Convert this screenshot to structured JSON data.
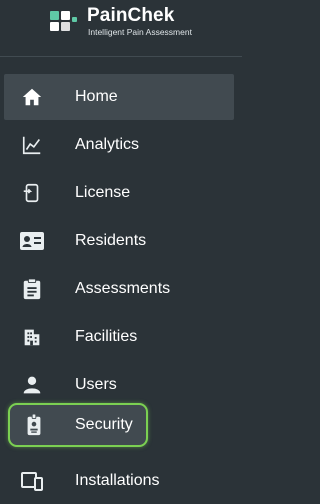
{
  "brand": {
    "name": "PainChek",
    "tagline": "Intelligent Pain Assessment"
  },
  "sidebar": {
    "items": [
      {
        "label": "Home",
        "icon": "home-icon",
        "state": "active"
      },
      {
        "label": "Analytics",
        "icon": "chart-line-icon"
      },
      {
        "label": "License",
        "icon": "license-icon"
      },
      {
        "label": "Residents",
        "icon": "id-card-icon"
      },
      {
        "label": "Assessments",
        "icon": "clipboard-icon"
      },
      {
        "label": "Facilities",
        "icon": "building-icon"
      },
      {
        "label": "Users",
        "icon": "user-icon"
      },
      {
        "label": "Security",
        "icon": "badge-icon",
        "state": "highlighted"
      },
      {
        "label": "Installations",
        "icon": "devices-icon"
      }
    ]
  },
  "colors": {
    "background": "#2b3338",
    "active_item": "#414a50",
    "highlight_border": "#7bd052",
    "icon": "#e9eef0",
    "logo_accent": "#5fc9a6"
  }
}
